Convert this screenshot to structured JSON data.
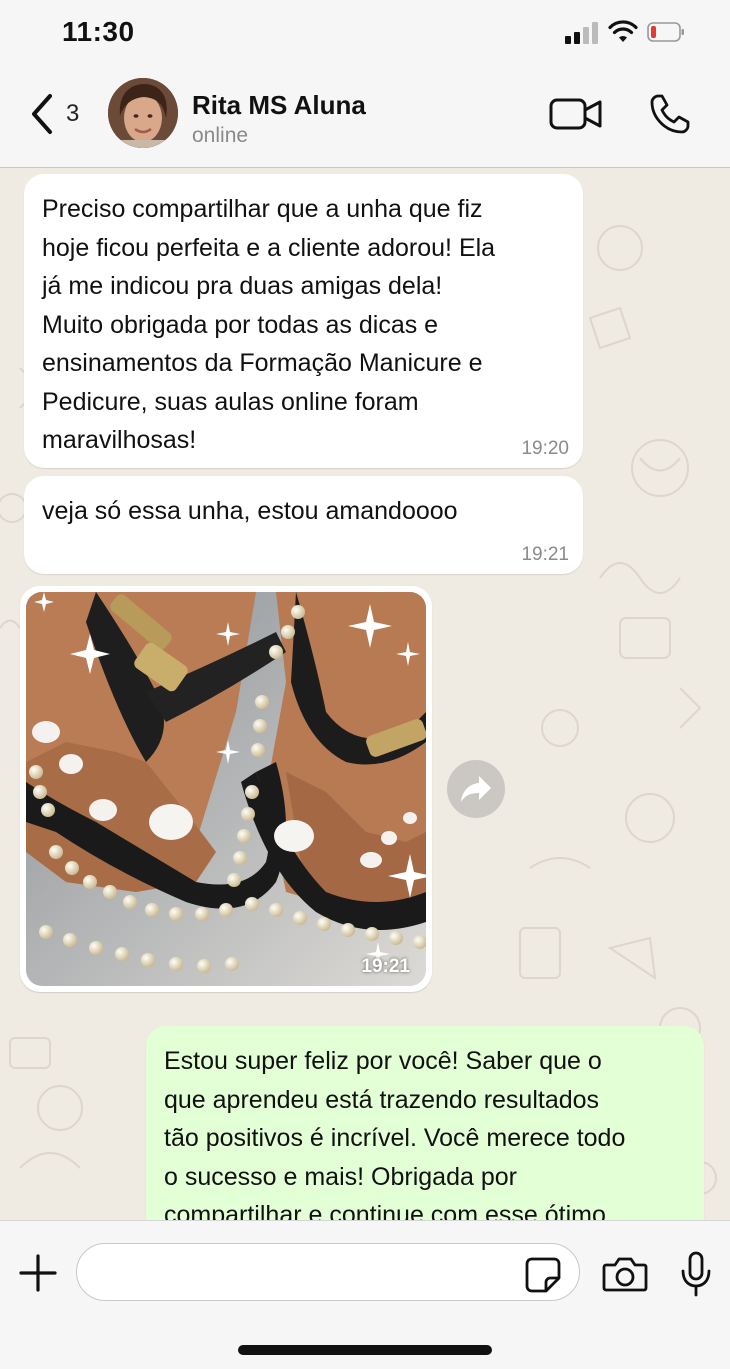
{
  "status_bar": {
    "time": "11:30"
  },
  "header": {
    "back_count": "3",
    "contact_name": "Rita MS Aluna",
    "contact_status": "online"
  },
  "messages": [
    {
      "direction": "incoming",
      "text": "Preciso compartilhar que a unha que fiz\nhoje ficou perfeita e a cliente adorou! Ela\njá me indicou pra duas amigas dela!\nMuito obrigada por todas as dicas e\nensinamentos da Formação Manicure e\nPedicure, suas aulas online foram\nmaravilhosas!",
      "time": "19:20"
    },
    {
      "direction": "incoming",
      "text": "veja só essa unha, estou amandoooo",
      "time": "19:21"
    },
    {
      "direction": "incoming",
      "type": "image",
      "time": "19:21"
    },
    {
      "direction": "outgoing",
      "text": "Estou super feliz por você! Saber que o\nque aprendeu está trazendo resultados\ntão positivos é incrível. Você merece todo\no sucesso e mais! Obrigada por\ncompartilhar e continue com esse ótimo",
      "time": ""
    }
  ],
  "input": {
    "placeholder": ""
  },
  "icons": {
    "back": "chevron-left-icon",
    "video": "video-camera-icon",
    "phone": "phone-icon",
    "forward": "forward-icon",
    "plus": "plus-icon",
    "sticker": "sticker-icon",
    "camera": "camera-icon",
    "mic": "microphone-icon"
  },
  "colors": {
    "incoming_bubble": "#ffffff",
    "outgoing_bubble": "#e2ffd6",
    "chat_background": "#efeae2",
    "battery_low": "#e53935"
  }
}
